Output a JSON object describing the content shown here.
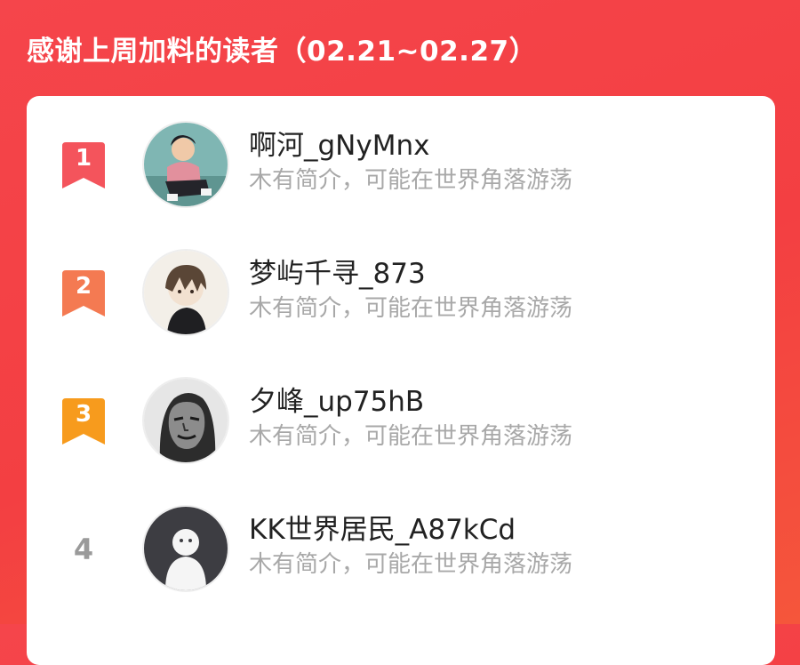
{
  "header": {
    "title": "感谢上周加料的读者（02.21~02.27）"
  },
  "colors": {
    "background": "#f33f42",
    "rank1": "#f4545c",
    "rank2": "#f47a52",
    "rank3": "#f79b1d",
    "rank_plain": "#9a9a9a",
    "username": "#222222",
    "bio": "#a8a8a8"
  },
  "readers": [
    {
      "rank": "1",
      "name": "啊河_gNyMnx",
      "bio": "木有简介，可能在世界角落游荡",
      "avatar": "avatar-boy-pink-shirt"
    },
    {
      "rank": "2",
      "name": "梦屿千寻_873",
      "bio": "木有简介，可能在世界角落游荡",
      "avatar": "avatar-anime-boy"
    },
    {
      "rank": "3",
      "name": "夕峰_up75hB",
      "bio": "木有简介，可能在世界角落游荡",
      "avatar": "avatar-sketch-face"
    },
    {
      "rank": "4",
      "name": "KK世界居民_A87kCd",
      "bio": "木有简介，可能在世界角落游荡",
      "avatar": "avatar-default-person"
    }
  ]
}
